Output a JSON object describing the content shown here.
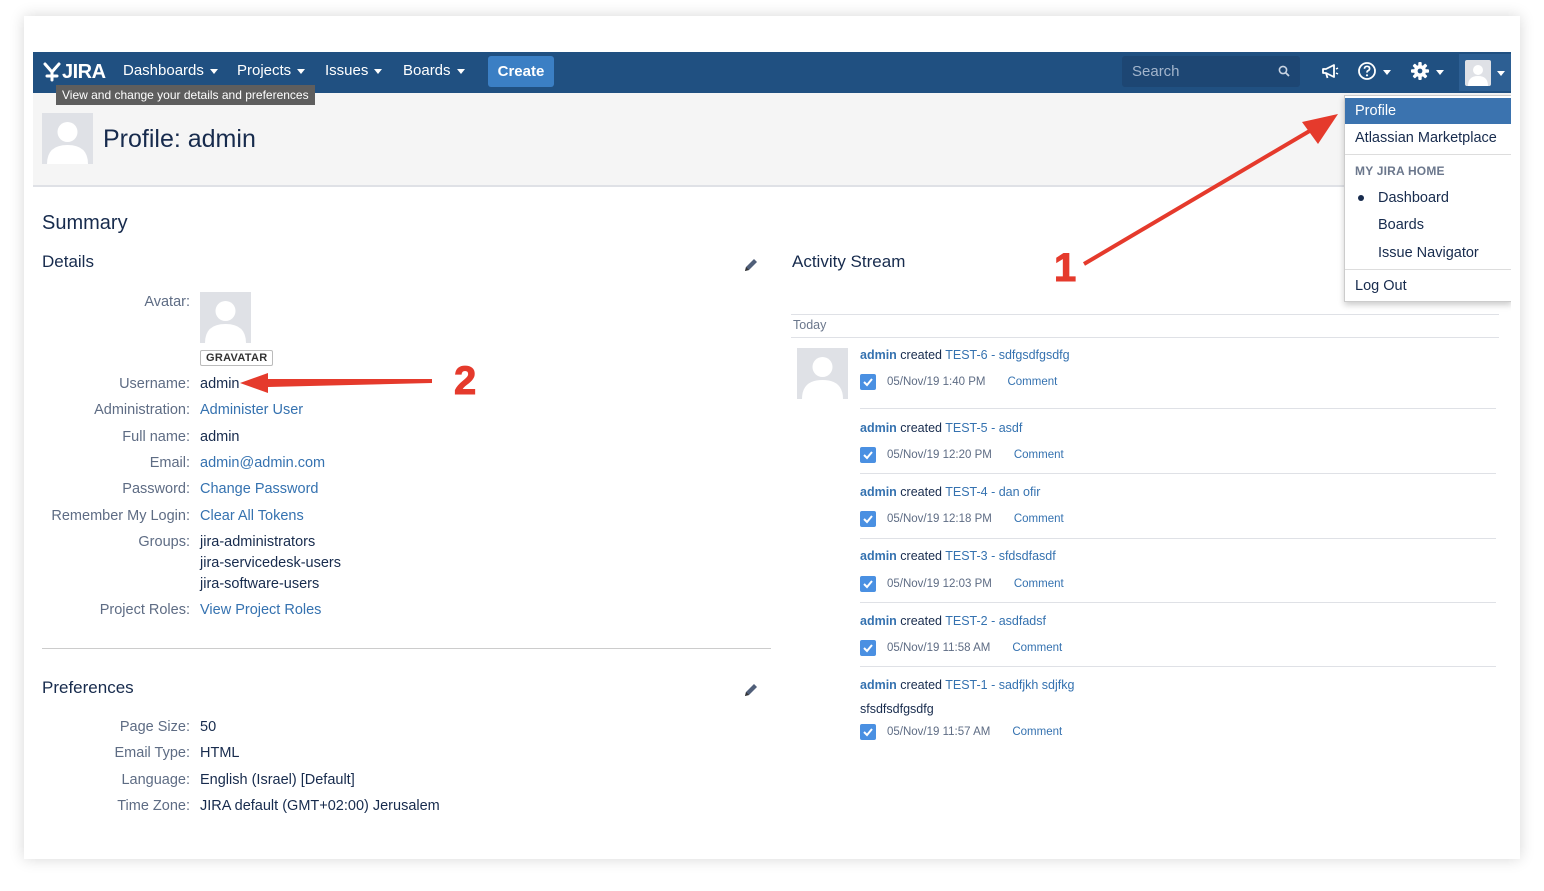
{
  "header": {
    "logo_text": "JIRA",
    "nav": [
      {
        "label": "Dashboards"
      },
      {
        "label": "Projects"
      },
      {
        "label": "Issues"
      },
      {
        "label": "Boards"
      }
    ],
    "create_label": "Create",
    "search_placeholder": "Search"
  },
  "tooltip": "View and change your details and preferences",
  "page_title": "Profile: admin",
  "summary_title": "Summary",
  "details": {
    "title": "Details",
    "avatar_label": "Avatar:",
    "gravatar_badge": "GRAVATAR",
    "fields": [
      {
        "label": "Username:",
        "value": "admin"
      },
      {
        "label": "Administration:",
        "value": "Administer User"
      },
      {
        "label": "Full name:",
        "value": "admin"
      },
      {
        "label": "Email:",
        "value": "admin@admin.com"
      },
      {
        "label": "Password:",
        "value": "Change Password"
      },
      {
        "label": "Remember My Login:",
        "value": "Clear All Tokens"
      },
      {
        "label": "Groups:",
        "values": [
          "jira-administrators",
          "jira-servicedesk-users",
          "jira-software-users"
        ]
      },
      {
        "label": "Project Roles:",
        "value": "View Project Roles"
      }
    ]
  },
  "preferences": {
    "title": "Preferences",
    "fields": [
      {
        "label": "Page Size:",
        "value": "50"
      },
      {
        "label": "Email Type:",
        "value": "HTML"
      },
      {
        "label": "Language:",
        "value": "English (Israel) [Default]"
      },
      {
        "label": "Time Zone:",
        "value": "JIRA default (GMT+02:00) Jerusalem"
      }
    ]
  },
  "activity": {
    "title": "Activity Stream",
    "day_label": "Today",
    "items": [
      {
        "user": "admin",
        "verb": " created ",
        "issue": "TEST-6 - sdfgsdfgsdfg",
        "time": "05/Nov/19 1:40 PM",
        "action": "Comment"
      },
      {
        "user": "admin",
        "verb": " created ",
        "issue": "TEST-5 - asdf",
        "time": "05/Nov/19 12:20 PM",
        "action": "Comment"
      },
      {
        "user": "admin",
        "verb": " created ",
        "issue": "TEST-4 - dan ofir",
        "time": "05/Nov/19 12:18 PM",
        "action": "Comment"
      },
      {
        "user": "admin",
        "verb": " created ",
        "issue": "TEST-3 - sfdsdfasdf",
        "time": "05/Nov/19 12:03 PM",
        "action": "Comment"
      },
      {
        "user": "admin",
        "verb": " created ",
        "issue": "TEST-2 - asdfadsf",
        "time": "05/Nov/19 11:58 AM",
        "action": "Comment"
      },
      {
        "user": "admin",
        "verb": " created ",
        "issue": "TEST-1 - sadfjkh sdjfkg",
        "description": "sfsdfsdfgsdfg",
        "time": "05/Nov/19 11:57 AM",
        "action": "Comment"
      }
    ]
  },
  "user_menu": {
    "items": [
      "Profile",
      "Atlassian Marketplace"
    ],
    "section_heading": "MY JIRA HOME",
    "home_options": [
      "Dashboard",
      "Boards",
      "Issue Navigator"
    ],
    "selected_home": "Dashboard",
    "logout": "Log Out"
  },
  "annotations": [
    "1",
    "2"
  ],
  "colors": {
    "header_bg": "#205081",
    "create_button": "#3b7fc4",
    "link": "#3572b0",
    "menu_active": "#3b73af",
    "annotation_arrow": "#e53a2c"
  }
}
